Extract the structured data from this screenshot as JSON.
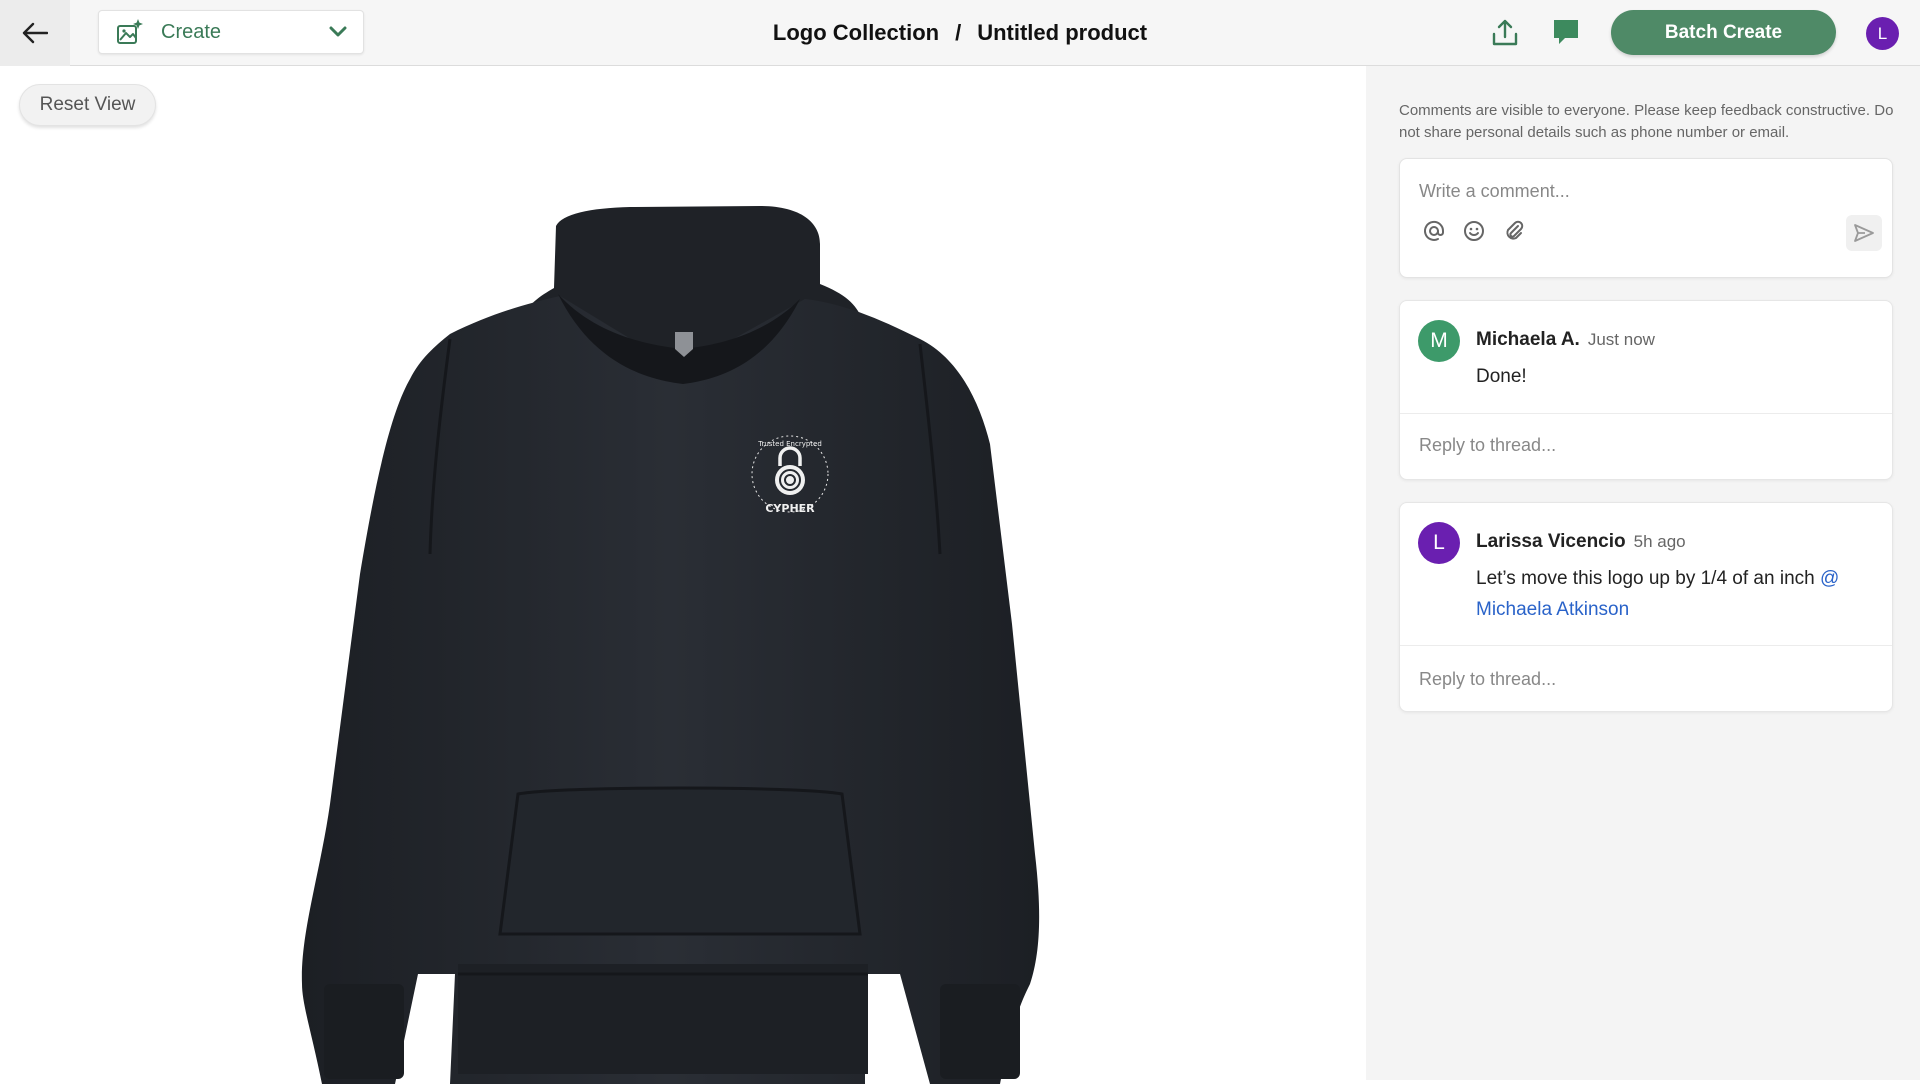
{
  "header": {
    "create_label": "Create",
    "breadcrumb": {
      "collection": "Logo Collection",
      "separator": "/",
      "product": "Untitled product"
    },
    "batch_create_label": "Batch Create",
    "user_avatar_initial": "L",
    "accent_color": "#4f8a67"
  },
  "canvas": {
    "reset_view_label": "Reset View",
    "product": {
      "type": "hoodie",
      "color": "#25292f",
      "logo_text_top": "Trusted Encrypted",
      "logo_text_bottom": "CYPHER"
    }
  },
  "comments": {
    "notice": "Comments are visible to everyone. Please keep feedback constructive. Do not share personal details such as phone number or email.",
    "composer_placeholder": "Write a comment...",
    "composer_tools": [
      "at-icon",
      "emoji-icon",
      "paperclip-icon",
      "send-icon"
    ],
    "threads": [
      {
        "initial": "M",
        "avatar_color": "#3d9a6a",
        "author": "Michaela A.",
        "time": "Just now",
        "text": "Done!",
        "mention": "",
        "reply_placeholder": "Reply to thread..."
      },
      {
        "initial": "L",
        "avatar_color": "#6a1fb0",
        "author": "Larissa Vicencio",
        "time": "5h ago",
        "text": "Let’s move this logo up by 1/4 of an inch ",
        "mention": "@ Michaela Atkinson",
        "reply_placeholder": "Reply to thread..."
      }
    ]
  }
}
